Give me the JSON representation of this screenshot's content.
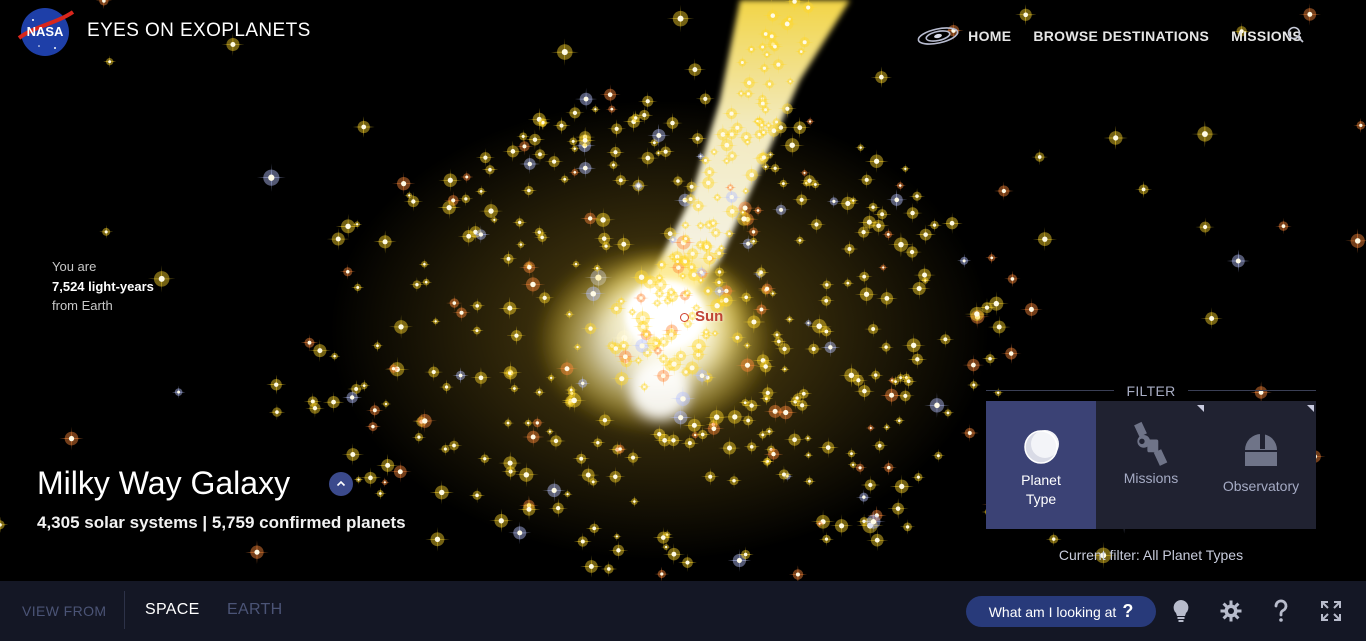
{
  "header": {
    "logo_text": "NASA",
    "site_title": "EYES ON EXOPLANETS",
    "nav": [
      {
        "label": "HOME",
        "icon": "galaxy-icon"
      },
      {
        "label": "BROWSE DESTINATIONS"
      },
      {
        "label": "MISSIONS"
      }
    ],
    "search_icon": "search-icon"
  },
  "distance": {
    "line1": "You are",
    "value": "7,524 light-years",
    "line3": "from Earth"
  },
  "scene": {
    "sun_label": "Sun"
  },
  "galaxy": {
    "title": "Milky Way Galaxy",
    "stats": "4,305 solar systems | 5,759 confirmed planets"
  },
  "filter": {
    "label": "FILTER",
    "tiles": [
      {
        "line1": "Planet",
        "line2": "Type",
        "icon": "planet-icon",
        "active": true
      },
      {
        "line1": "Missions",
        "line2": "",
        "icon": "satellite-icon",
        "active": false
      },
      {
        "line1": "Observatory",
        "line2": "",
        "icon": "observatory-icon",
        "active": false
      }
    ],
    "current": "Current filter: All Planet Types"
  },
  "bottombar": {
    "view_from": "VIEW FROM",
    "space": "SPACE",
    "earth": "EARTH",
    "what_label": "What am I looking at",
    "what_q": "?",
    "icons": [
      "lightbulb-icon",
      "gear-icon",
      "help-icon",
      "fullscreen-icon"
    ]
  },
  "colors": {
    "background": "#000000",
    "bar": "#141725",
    "accent": "#283a7a",
    "active_tile": "#3b4275",
    "star_yellow": "#ffd82a",
    "star_orange": "#ff8a3a",
    "star_blue": "#b8c4ff"
  }
}
